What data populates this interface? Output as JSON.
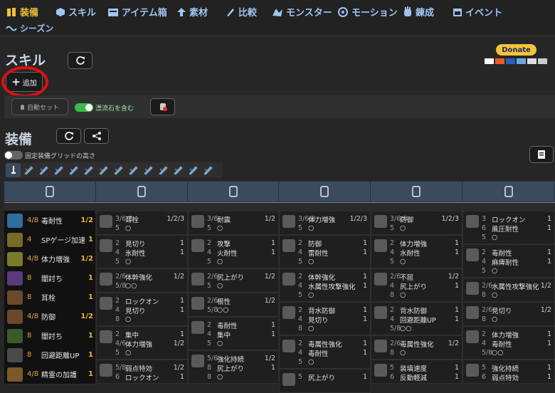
{
  "nav": {
    "items": [
      {
        "label": "装備",
        "icon": "equipment-icon",
        "active": true
      },
      {
        "label": "スキル",
        "icon": "skill-cube-icon"
      },
      {
        "label": "アイテム箱",
        "icon": "item-box-icon"
      },
      {
        "label": "素材",
        "icon": "material-arrow-icon"
      },
      {
        "label": "比較",
        "icon": "compare-icon"
      },
      {
        "label": "モンスター",
        "icon": "monster-icon"
      },
      {
        "label": "モーション",
        "icon": "motion-icon"
      },
      {
        "label": "錬成",
        "icon": "forge-hand-icon"
      },
      {
        "label": "イベント",
        "icon": "calendar-icon"
      },
      {
        "label": "シーズン",
        "icon": "season-icon"
      }
    ]
  },
  "skills": {
    "title": "スキル",
    "add_label": "追加",
    "auto_set_label": "自動セット",
    "include_label": "漂流石を含む"
  },
  "donate": {
    "label": "Donate",
    "cards": [
      "VISA",
      "MC",
      "Maestro",
      "AMEX",
      "Bank",
      "Discover"
    ]
  },
  "equip": {
    "title": "装備",
    "fixed_grid_label": "固定装備グリッドの高さ"
  },
  "colors": {
    "accent": "#f3c23b",
    "nav": "#9fc5f0",
    "header": "#3b4b5e",
    "level": "#e8a33d",
    "toggle_on": "#3dbb4a"
  },
  "weapon_icons": [
    "great-sword-icon",
    "long-sword-icon",
    "sword-shield-icon",
    "dual-blades-icon",
    "hammer-icon",
    "hunting-horn-icon",
    "lance-icon",
    "gunlance-icon",
    "switch-axe-icon",
    "charge-blade-icon",
    "insect-glaive-icon",
    "light-bowgun-icon",
    "heavy-bowgun-icon",
    "bow-icon"
  ],
  "columns": [
    "talisman-icon",
    "head-armor-icon",
    "chest-armor-icon",
    "arm-armor-icon",
    "waist-armor-icon",
    "leg-armor-icon"
  ],
  "skill_list": [
    {
      "lv": "4/8",
      "name": "毒耐性",
      "max": "1/2",
      "color": "#2d6f9a"
    },
    {
      "lv": "4",
      "name": "SPゲージ加速",
      "max": "1",
      "color": "#7a6a2a"
    },
    {
      "lv": "4/8",
      "name": "体力増強",
      "max": "1/2",
      "color": "#7a7a2a"
    },
    {
      "lv": "8",
      "name": "闇討ち",
      "max": "1",
      "color": "#5a3a7a"
    },
    {
      "lv": "8",
      "name": "耳栓",
      "max": "1",
      "color": "#6a4a2a"
    },
    {
      "lv": "4/8",
      "name": "防御",
      "max": "1/2",
      "color": "#6a4a2a"
    },
    {
      "lv": "8",
      "name": "闇討ち",
      "max": "1",
      "color": "#3a5a2a"
    },
    {
      "lv": "8",
      "name": "回避距離UP",
      "max": "1",
      "color": "#4a4a4a"
    },
    {
      "lv": "4/8",
      "name": "精霊の加護",
      "max": "1",
      "color": "#7a5a2a"
    }
  ],
  "cells": [
    [
      {
        "lines": [
          {
            "n": "3/6/8",
            "t": "耳栓",
            "r": "1/2/3"
          },
          {
            "n": "5",
            "t": "○",
            "r": ""
          }
        ]
      },
      {
        "lines": [
          {
            "n": "2",
            "t": "見切り",
            "r": "1"
          },
          {
            "n": "4",
            "t": "氷耐性",
            "r": "1"
          },
          {
            "n": "5",
            "t": "○",
            "r": ""
          }
        ]
      },
      {
        "lines": [
          {
            "n": "2/6",
            "t": "体幹強化",
            "r": "1/2"
          },
          {
            "n": "5/8",
            "t": "○○",
            "r": ""
          }
        ]
      },
      {
        "lines": [
          {
            "n": "2",
            "t": "ロックオン",
            "r": "1"
          },
          {
            "n": "4",
            "t": "見切り",
            "r": "1"
          },
          {
            "n": "8",
            "t": "○",
            "r": ""
          }
        ]
      },
      {
        "lines": [
          {
            "n": "2",
            "t": "集中",
            "r": "1"
          },
          {
            "n": "4/6",
            "t": "体力増強",
            "r": "1/2"
          },
          {
            "n": "5",
            "t": "○",
            "r": ""
          }
        ]
      },
      {
        "lines": [
          {
            "n": "5/8",
            "t": "弱点特効",
            "r": "1/2"
          },
          {
            "n": "6",
            "t": "ロックオン",
            "r": "1"
          }
        ]
      }
    ],
    [
      {
        "lines": [
          {
            "n": "3/6",
            "t": "耐震",
            "r": "1/2"
          },
          {
            "n": "5",
            "t": "○",
            "r": ""
          }
        ]
      },
      {
        "lines": [
          {
            "n": "2",
            "t": "攻撃",
            "r": "1"
          },
          {
            "n": "4",
            "t": "火耐性",
            "r": "1"
          },
          {
            "n": "5",
            "t": "○",
            "r": ""
          }
        ]
      },
      {
        "lines": [
          {
            "n": "2/6",
            "t": "尻上がり",
            "r": "1/2"
          },
          {
            "n": "5",
            "t": "○",
            "r": ""
          }
        ]
      },
      {
        "lines": [
          {
            "n": "2/6",
            "t": "根性",
            "r": "1/2"
          },
          {
            "n": "5/8",
            "t": "○○",
            "r": ""
          }
        ]
      },
      {
        "lines": [
          {
            "n": "2",
            "t": "毒耐性",
            "r": "1"
          },
          {
            "n": "4",
            "t": "集中",
            "r": "1"
          },
          {
            "n": "5",
            "t": "○",
            "r": ""
          }
        ]
      },
      {
        "lines": [
          {
            "n": "5/6",
            "t": "強化持続",
            "r": "1/2"
          },
          {
            "n": "8",
            "t": "尻上がり",
            "r": "1"
          },
          {
            "n": "8",
            "t": "○",
            "r": ""
          }
        ]
      }
    ],
    [
      {
        "lines": [
          {
            "n": "3/6/8",
            "t": "体力増強",
            "r": "1/2/3"
          },
          {
            "n": "5",
            "t": "○",
            "r": ""
          }
        ]
      },
      {
        "lines": [
          {
            "n": "2",
            "t": "防御",
            "r": "1"
          },
          {
            "n": "4",
            "t": "雷耐性",
            "r": "1"
          },
          {
            "n": "5",
            "t": "○",
            "r": ""
          }
        ]
      },
      {
        "lines": [
          {
            "n": "2",
            "t": "体幹強化",
            "r": "1"
          },
          {
            "n": "4",
            "t": "水属性攻撃強化",
            "r": "1"
          },
          {
            "n": "5",
            "t": "○",
            "r": ""
          }
        ]
      },
      {
        "lines": [
          {
            "n": "2",
            "t": "背水防御",
            "r": "1"
          },
          {
            "n": "4",
            "t": "見切り",
            "r": "1"
          },
          {
            "n": "8",
            "t": "○",
            "r": ""
          }
        ]
      },
      {
        "lines": [
          {
            "n": "2",
            "t": "毒属性強化",
            "r": "1"
          },
          {
            "n": "4",
            "t": "毒耐性",
            "r": "1"
          },
          {
            "n": "5",
            "t": "○",
            "r": ""
          }
        ]
      },
      {
        "lines": [
          {
            "n": "5",
            "t": "尻上がり",
            "r": "1"
          }
        ]
      }
    ],
    [
      {
        "lines": [
          {
            "n": "3/6/8",
            "t": "防御",
            "r": "1/2/3"
          },
          {
            "n": "5",
            "t": "○",
            "r": ""
          }
        ]
      },
      {
        "lines": [
          {
            "n": "2",
            "t": "体力増強",
            "r": "1"
          },
          {
            "n": "4",
            "t": "水耐性",
            "r": "1"
          },
          {
            "n": "5",
            "t": "○",
            "r": ""
          }
        ]
      },
      {
        "lines": [
          {
            "n": "2/6",
            "t": "不屈",
            "r": "1/2"
          },
          {
            "n": "4",
            "t": "尻上がり",
            "r": "1"
          },
          {
            "n": "8",
            "t": "○",
            "r": ""
          }
        ]
      },
      {
        "lines": [
          {
            "n": "2",
            "t": "背水防御",
            "r": "1"
          },
          {
            "n": "4",
            "t": "回避距離UP",
            "r": "1"
          },
          {
            "n": "5/8",
            "t": "○○",
            "r": ""
          }
        ]
      },
      {
        "lines": [
          {
            "n": "2/6",
            "t": "毒属性強化",
            "r": "1/2"
          },
          {
            "n": "8",
            "t": "○",
            "r": ""
          }
        ]
      },
      {
        "lines": [
          {
            "n": "5",
            "t": "装填速度",
            "r": "1"
          },
          {
            "n": "6",
            "t": "反動軽減",
            "r": "1"
          }
        ]
      }
    ],
    [
      {
        "lines": [
          {
            "n": "3",
            "t": "ロックオン",
            "r": "1"
          },
          {
            "n": "6",
            "t": "風圧耐性",
            "r": "1"
          },
          {
            "n": "5",
            "t": "○",
            "r": ""
          }
        ]
      },
      {
        "lines": [
          {
            "n": "2",
            "t": "毒耐性",
            "r": "1"
          },
          {
            "n": "4",
            "t": "麻痺耐性",
            "r": "1"
          },
          {
            "n": "5",
            "t": "○",
            "r": ""
          }
        ]
      },
      {
        "lines": [
          {
            "n": "2/6",
            "t": "水属性攻撃強化",
            "r": "1/2"
          },
          {
            "n": "8",
            "t": "○",
            "r": ""
          }
        ]
      },
      {
        "lines": [
          {
            "n": "2/6",
            "t": "見切り",
            "r": "1/2"
          },
          {
            "n": "8",
            "t": "○",
            "r": ""
          }
        ]
      },
      {
        "lines": [
          {
            "n": "2",
            "t": "体力増強",
            "r": "1"
          },
          {
            "n": "4",
            "t": "毒耐性",
            "r": "1"
          },
          {
            "n": "5/8",
            "t": "○○",
            "r": ""
          }
        ]
      },
      {
        "lines": [
          {
            "n": "5",
            "t": "強化持続",
            "r": "1"
          },
          {
            "n": "6",
            "t": "弱点特効",
            "r": "1"
          }
        ]
      }
    ]
  ]
}
